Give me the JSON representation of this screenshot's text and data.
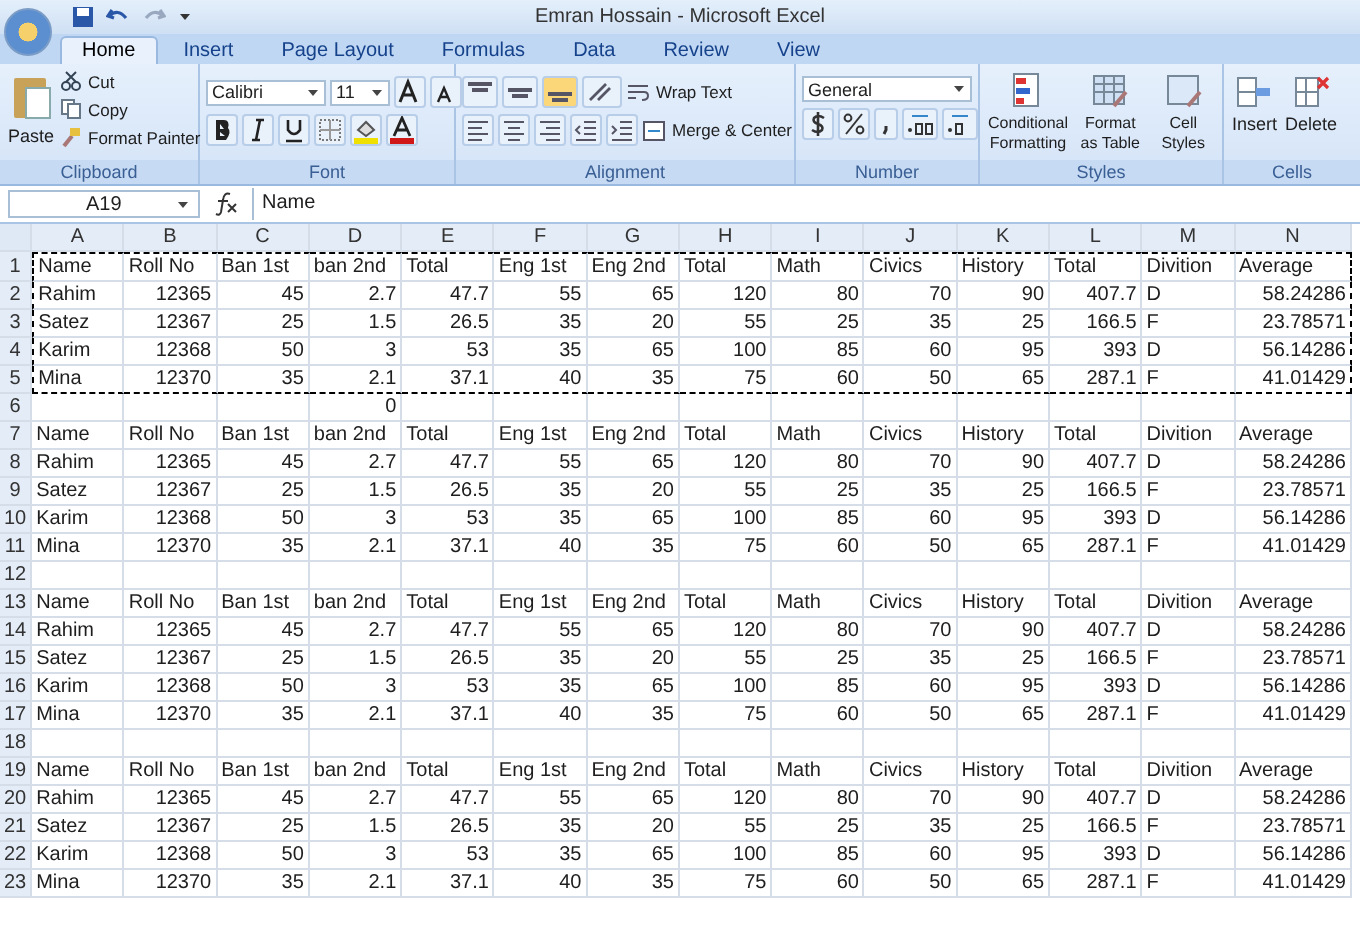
{
  "window": {
    "title": "Emran Hossain - Microsoft Excel"
  },
  "tabs": [
    {
      "label": "Home",
      "selected": true
    },
    {
      "label": "Insert",
      "selected": false
    },
    {
      "label": "Page Layout",
      "selected": false
    },
    {
      "label": "Formulas",
      "selected": false
    },
    {
      "label": "Data",
      "selected": false
    },
    {
      "label": "Review",
      "selected": false
    },
    {
      "label": "View",
      "selected": false
    }
  ],
  "ribbon": {
    "clipboard": {
      "label": "Clipboard",
      "paste": "Paste",
      "cut": "Cut",
      "copy": "Copy",
      "format_painter": "Format Painter"
    },
    "font": {
      "label": "Font",
      "family": "Calibri",
      "size": "11"
    },
    "alignment": {
      "label": "Alignment",
      "wrap_text": "Wrap Text",
      "merge_center": "Merge & Center"
    },
    "number": {
      "label": "Number",
      "format": "General"
    },
    "styles": {
      "label": "Styles",
      "conditional": "Conditional Formatting",
      "format_table": "Format as Table",
      "cell_styles": "Cell Styles"
    },
    "cells": {
      "label": "Cells",
      "insert": "Insert",
      "delete": "Delete"
    }
  },
  "formula_bar": {
    "name_box": "A19",
    "value": "Name"
  },
  "sheet": {
    "columns": [
      "A",
      "B",
      "C",
      "D",
      "E",
      "F",
      "G",
      "H",
      "I",
      "J",
      "K",
      "L",
      "M",
      "N"
    ],
    "rows": [
      {
        "number": "1",
        "in_copy_range": true,
        "cells": [
          "Name",
          "Roll No",
          "Ban 1st",
          "ban 2nd",
          "Total",
          "Eng 1st",
          "Eng 2nd",
          "Total",
          "Math",
          "Civics",
          "History",
          "Total",
          "Divition",
          "Average"
        ]
      },
      {
        "number": "2",
        "in_copy_range": true,
        "cells": [
          "Rahim",
          "12365",
          "45",
          "2.7",
          "47.7",
          "55",
          "65",
          "120",
          "80",
          "70",
          "90",
          "407.7",
          "D",
          "58.24286"
        ]
      },
      {
        "number": "3",
        "in_copy_range": true,
        "cells": [
          "Satez",
          "12367",
          "25",
          "1.5",
          "26.5",
          "35",
          "20",
          "55",
          "25",
          "35",
          "25",
          "166.5",
          "F",
          "23.78571"
        ]
      },
      {
        "number": "4",
        "in_copy_range": true,
        "cells": [
          "Karim",
          "12368",
          "50",
          "3",
          "53",
          "35",
          "65",
          "100",
          "85",
          "60",
          "95",
          "393",
          "D",
          "56.14286"
        ]
      },
      {
        "number": "5",
        "in_copy_range": true,
        "cells": [
          "Mina",
          "12370",
          "35",
          "2.1",
          "37.1",
          "40",
          "35",
          "75",
          "60",
          "50",
          "65",
          "287.1",
          "F",
          "41.01429"
        ]
      },
      {
        "number": "6",
        "in_copy_range": false,
        "cells": [
          null,
          null,
          null,
          "0",
          null,
          null,
          null,
          null,
          null,
          null,
          null,
          null,
          null,
          null
        ]
      },
      {
        "number": "7",
        "in_copy_range": false,
        "cells": [
          "Name",
          "Roll No",
          "Ban 1st",
          "ban 2nd",
          "Total",
          "Eng 1st",
          "Eng 2nd",
          "Total",
          "Math",
          "Civics",
          "History",
          "Total",
          "Divition",
          "Average"
        ]
      },
      {
        "number": "8",
        "in_copy_range": false,
        "cells": [
          "Rahim",
          "12365",
          "45",
          "2.7",
          "47.7",
          "55",
          "65",
          "120",
          "80",
          "70",
          "90",
          "407.7",
          "D",
          "58.24286"
        ]
      },
      {
        "number": "9",
        "in_copy_range": false,
        "cells": [
          "Satez",
          "12367",
          "25",
          "1.5",
          "26.5",
          "35",
          "20",
          "55",
          "25",
          "35",
          "25",
          "166.5",
          "F",
          "23.78571"
        ]
      },
      {
        "number": "10",
        "in_copy_range": false,
        "cells": [
          "Karim",
          "12368",
          "50",
          "3",
          "53",
          "35",
          "65",
          "100",
          "85",
          "60",
          "95",
          "393",
          "D",
          "56.14286"
        ]
      },
      {
        "number": "11",
        "in_copy_range": false,
        "cells": [
          "Mina",
          "12370",
          "35",
          "2.1",
          "37.1",
          "40",
          "35",
          "75",
          "60",
          "50",
          "65",
          "287.1",
          "F",
          "41.01429"
        ]
      },
      {
        "number": "12",
        "in_copy_range": false,
        "cells": [
          null,
          null,
          null,
          null,
          null,
          null,
          null,
          null,
          null,
          null,
          null,
          null,
          null,
          null
        ]
      },
      {
        "number": "13",
        "in_copy_range": false,
        "cells": [
          "Name",
          "Roll No",
          "Ban 1st",
          "ban 2nd",
          "Total",
          "Eng 1st",
          "Eng 2nd",
          "Total",
          "Math",
          "Civics",
          "History",
          "Total",
          "Divition",
          "Average"
        ]
      },
      {
        "number": "14",
        "in_copy_range": false,
        "cells": [
          "Rahim",
          "12365",
          "45",
          "2.7",
          "47.7",
          "55",
          "65",
          "120",
          "80",
          "70",
          "90",
          "407.7",
          "D",
          "58.24286"
        ]
      },
      {
        "number": "15",
        "in_copy_range": false,
        "cells": [
          "Satez",
          "12367",
          "25",
          "1.5",
          "26.5",
          "35",
          "20",
          "55",
          "25",
          "35",
          "25",
          "166.5",
          "F",
          "23.78571"
        ]
      },
      {
        "number": "16",
        "in_copy_range": false,
        "cells": [
          "Karim",
          "12368",
          "50",
          "3",
          "53",
          "35",
          "65",
          "100",
          "85",
          "60",
          "95",
          "393",
          "D",
          "56.14286"
        ]
      },
      {
        "number": "17",
        "in_copy_range": false,
        "cells": [
          "Mina",
          "12370",
          "35",
          "2.1",
          "37.1",
          "40",
          "35",
          "75",
          "60",
          "50",
          "65",
          "287.1",
          "F",
          "41.01429"
        ]
      },
      {
        "number": "18",
        "in_copy_range": false,
        "cells": [
          null,
          null,
          null,
          null,
          null,
          null,
          null,
          null,
          null,
          null,
          null,
          null,
          null,
          null
        ]
      },
      {
        "number": "19",
        "in_copy_range": false,
        "cells": [
          "Name",
          "Roll No",
          "Ban 1st",
          "ban 2nd",
          "Total",
          "Eng 1st",
          "Eng 2nd",
          "Total",
          "Math",
          "Civics",
          "History",
          "Total",
          "Divition",
          "Average"
        ]
      },
      {
        "number": "20",
        "in_copy_range": false,
        "cells": [
          "Rahim",
          "12365",
          "45",
          "2.7",
          "47.7",
          "55",
          "65",
          "120",
          "80",
          "70",
          "90",
          "407.7",
          "D",
          "58.24286"
        ]
      },
      {
        "number": "21",
        "in_copy_range": false,
        "cells": [
          "Satez",
          "12367",
          "25",
          "1.5",
          "26.5",
          "35",
          "20",
          "55",
          "25",
          "35",
          "25",
          "166.5",
          "F",
          "23.78571"
        ]
      },
      {
        "number": "22",
        "in_copy_range": false,
        "cells": [
          "Karim",
          "12368",
          "50",
          "3",
          "53",
          "35",
          "65",
          "100",
          "85",
          "60",
          "95",
          "393",
          "D",
          "56.14286"
        ]
      },
      {
        "number": "23",
        "in_copy_range": false,
        "cells": [
          "Mina",
          "12370",
          "35",
          "2.1",
          "37.1",
          "40",
          "35",
          "75",
          "60",
          "50",
          "65",
          "287.1",
          "F",
          "41.01429"
        ]
      }
    ]
  }
}
